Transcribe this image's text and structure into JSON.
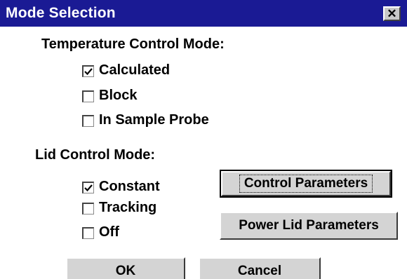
{
  "window": {
    "title": "Mode Selection",
    "close_symbol": "✕",
    "close_icon": "close-icon"
  },
  "temperature": {
    "heading": "Temperature Control Mode:",
    "options": [
      {
        "label": "Calculated",
        "checked": true
      },
      {
        "label": "Block",
        "checked": false
      },
      {
        "label": "In Sample Probe",
        "checked": false
      }
    ]
  },
  "lid": {
    "heading": "Lid Control Mode:",
    "options": [
      {
        "label": "Constant",
        "checked": true
      },
      {
        "label": "Tracking",
        "checked": false
      },
      {
        "label": "Off",
        "checked": false
      }
    ]
  },
  "buttons": {
    "control_parameters": "Control Parameters",
    "power_lid_parameters": "Power Lid Parameters",
    "ok": "OK",
    "cancel": "Cancel"
  },
  "colors": {
    "titlebar": "#1a1a94",
    "button_face": "#d4d4d4"
  }
}
